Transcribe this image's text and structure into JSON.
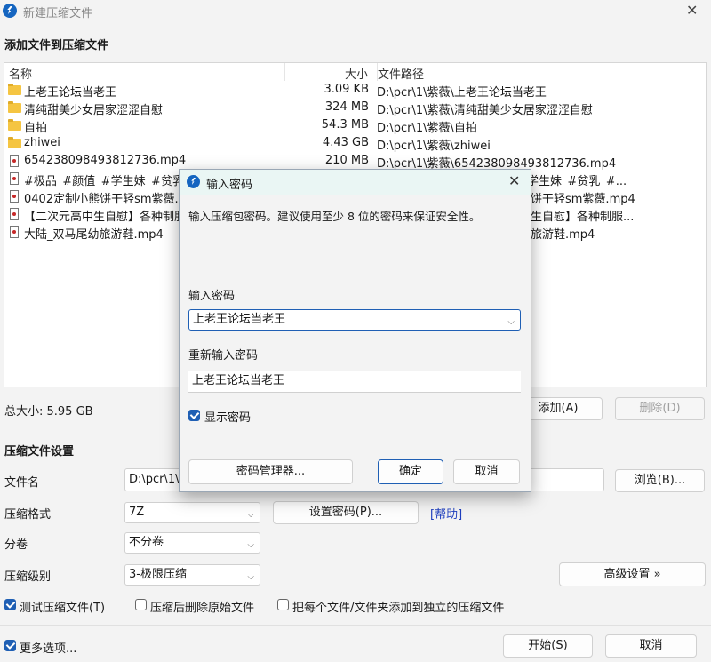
{
  "window": {
    "title": "新建压缩文件",
    "close_glyph": "✕"
  },
  "add_section": {
    "title": "添加文件到压缩文件"
  },
  "file_list": {
    "columns": {
      "name": "名称",
      "size": "大小",
      "path": "文件路径"
    },
    "rows": [
      {
        "type": "folder",
        "name": "上老王论坛当老王",
        "size": "3.09 KB",
        "path": "D:\\pcr\\1\\紫薇\\上老王论坛当老王"
      },
      {
        "type": "folder",
        "name": "清纯甜美少女居家涩涩自慰",
        "size": "324 MB",
        "path": "D:\\pcr\\1\\紫薇\\清纯甜美少女居家涩涩自慰"
      },
      {
        "type": "folder",
        "name": "自拍",
        "size": "54.3 MB",
        "path": "D:\\pcr\\1\\紫薇\\自拍"
      },
      {
        "type": "folder",
        "name": "zhiwei",
        "size": "4.43 GB",
        "path": "D:\\pcr\\1\\紫薇\\zhiwei"
      },
      {
        "type": "video",
        "name": "654238098493812736.mp4",
        "size": "210 MB",
        "path": "D:\\pcr\\1\\紫薇\\654238098493812736.mp4"
      },
      {
        "type": "video",
        "name": "#极品_#颜值_#学生妹_#贫乳_",
        "size": "",
        "path": "学生妹_#贫乳_#..."
      },
      {
        "type": "video",
        "name": "0402定制小熊饼干轻sm紫薇.r",
        "size": "",
        "path": "饼干轻sm紫薇.mp4"
      },
      {
        "type": "video",
        "name": "【二次元高中生自慰】各种制服",
        "size": "",
        "path": "生自慰】各种制服..."
      },
      {
        "type": "video",
        "name": "大陆_双马尾幼旅游鞋.mp4",
        "size": "",
        "path": "旅游鞋.mp4"
      }
    ]
  },
  "summary": {
    "total_size": "总大小: 5.95 GB"
  },
  "buttons": {
    "add": "添加(A)",
    "delete": "删除(D)",
    "browse": "浏览(B)...",
    "set_password": "设置密码(P)...",
    "help": "[帮助]",
    "advanced": "高级设置 »",
    "start": "开始(S)",
    "cancel": "取消"
  },
  "settings": {
    "title": "压缩文件设置",
    "filename_label": "文件名",
    "filename_value": "D:\\pcr\\1\\",
    "format_label": "压缩格式",
    "format_value": "7Z",
    "volume_label": "分卷",
    "volume_value": "不分卷",
    "level_label": "压缩级别",
    "level_value": "3-极限压缩",
    "test_archive": {
      "label": "测试压缩文件(T)",
      "checked": true
    },
    "delete_after": {
      "label": "压缩后删除原始文件",
      "checked": false
    },
    "separate_archives": {
      "label": "把每个文件/文件夹添加到独立的压缩文件",
      "checked": false
    },
    "more_options": {
      "label": "更多选项...",
      "checked": true
    }
  },
  "password_dialog": {
    "title": "输入密码",
    "description": "输入压缩包密码。建议使用至少 8 位的密码来保证安全性。",
    "password_label": "输入密码",
    "password_value": "上老王论坛当老王",
    "confirm_label": "重新输入密码",
    "confirm_value": "上老王论坛当老王",
    "show_password": {
      "label": "显示密码",
      "checked": true
    },
    "manager_button": "密码管理器...",
    "ok_button": "确定",
    "cancel_button": "取消"
  },
  "colors": {
    "accent": "#1f5fb4",
    "dialog_title_bg": "#eaf6f4",
    "folder": "#f5c542",
    "link": "#1f3fbf"
  },
  "icons": {
    "app": "bolt-icon",
    "folder": "folder-icon",
    "video": "video-file-icon",
    "close": "close-icon",
    "dropdown": "chevron-down-icon"
  }
}
